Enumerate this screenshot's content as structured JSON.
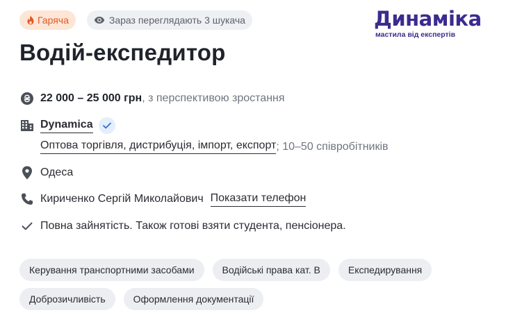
{
  "badges": {
    "hot_label": "Гаряча",
    "viewers_label": "Зараз переглядають 3 шукача"
  },
  "logo": {
    "word": "Динаміка",
    "tagline": "мастила від експертів",
    "color": "#3c2b8f"
  },
  "title": "Водій-експедитор",
  "salary": {
    "value": "22 000 – 25 000 грн",
    "note": ", з перспективою зростання"
  },
  "company": {
    "name": "Dynamica",
    "industry": "Оптова торгівля, дистрибуція, імпорт, експорт",
    "size": "; 10–50 співробітників"
  },
  "location": {
    "city": "Одеса"
  },
  "contact": {
    "person": "Кириченко Сергій Миколайович",
    "phone_link": "Показати телефон"
  },
  "employment": "Повна зайнятість. Також готові взяти студента, пенсіонера.",
  "tags": [
    "Керування транспортними засобами",
    "Водійські права кат. B",
    "Експедирування",
    "Доброзичливість",
    "Оформлення документації"
  ],
  "colors": {
    "hot": "#e05a24",
    "hot_bg": "#fde6d6",
    "tag_bg": "#eceef2",
    "verified_bg": "#e4eefc",
    "verified_check": "#2f6fd6"
  }
}
